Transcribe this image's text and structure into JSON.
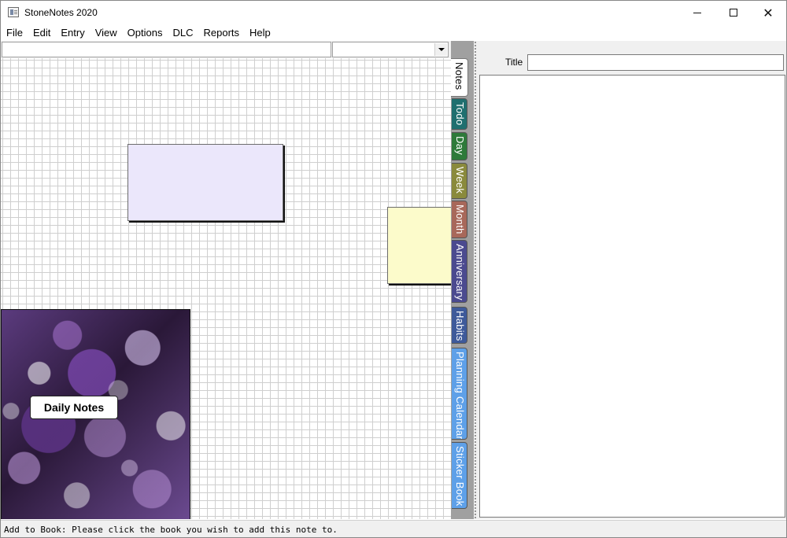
{
  "window": {
    "title": "StoneNotes 2020",
    "minimize_glyph": "",
    "close_glyph": "✕"
  },
  "menu": {
    "items": [
      "File",
      "Edit",
      "Entry",
      "View",
      "Options",
      "DLC",
      "Reports",
      "Help"
    ]
  },
  "toolbar": {
    "search_value": "",
    "combo_value": ""
  },
  "canvas": {
    "book_label": "Daily Notes",
    "colors": {
      "note_purple": "#ebe7fb",
      "note_yellow": "#fcfbcb"
    }
  },
  "tabs": [
    {
      "label": "Notes",
      "color": "#ffffff",
      "active": true
    },
    {
      "label": "Todo",
      "color": "#1f6f6f",
      "active": false
    },
    {
      "label": "Day",
      "color": "#2e7a3a",
      "active": false
    },
    {
      "label": "Week",
      "color": "#8a8a3c",
      "active": false
    },
    {
      "label": "Month",
      "color": "#a8685a",
      "active": false
    },
    {
      "label": "Anniversary",
      "color": "#4b4a8f",
      "active": false
    },
    {
      "label": "Habits",
      "color": "#3e5a9a",
      "active": false
    },
    {
      "label": "Planning Calendar",
      "color": "#5ea0e8",
      "active": false
    },
    {
      "label": "Sticker Book",
      "color": "#5ea0e8",
      "active": false
    }
  ],
  "editor": {
    "title_label": "Title",
    "title_value": "",
    "body_text": ""
  },
  "status": {
    "text": "Add to Book: Please click the book you wish to add this note to."
  }
}
